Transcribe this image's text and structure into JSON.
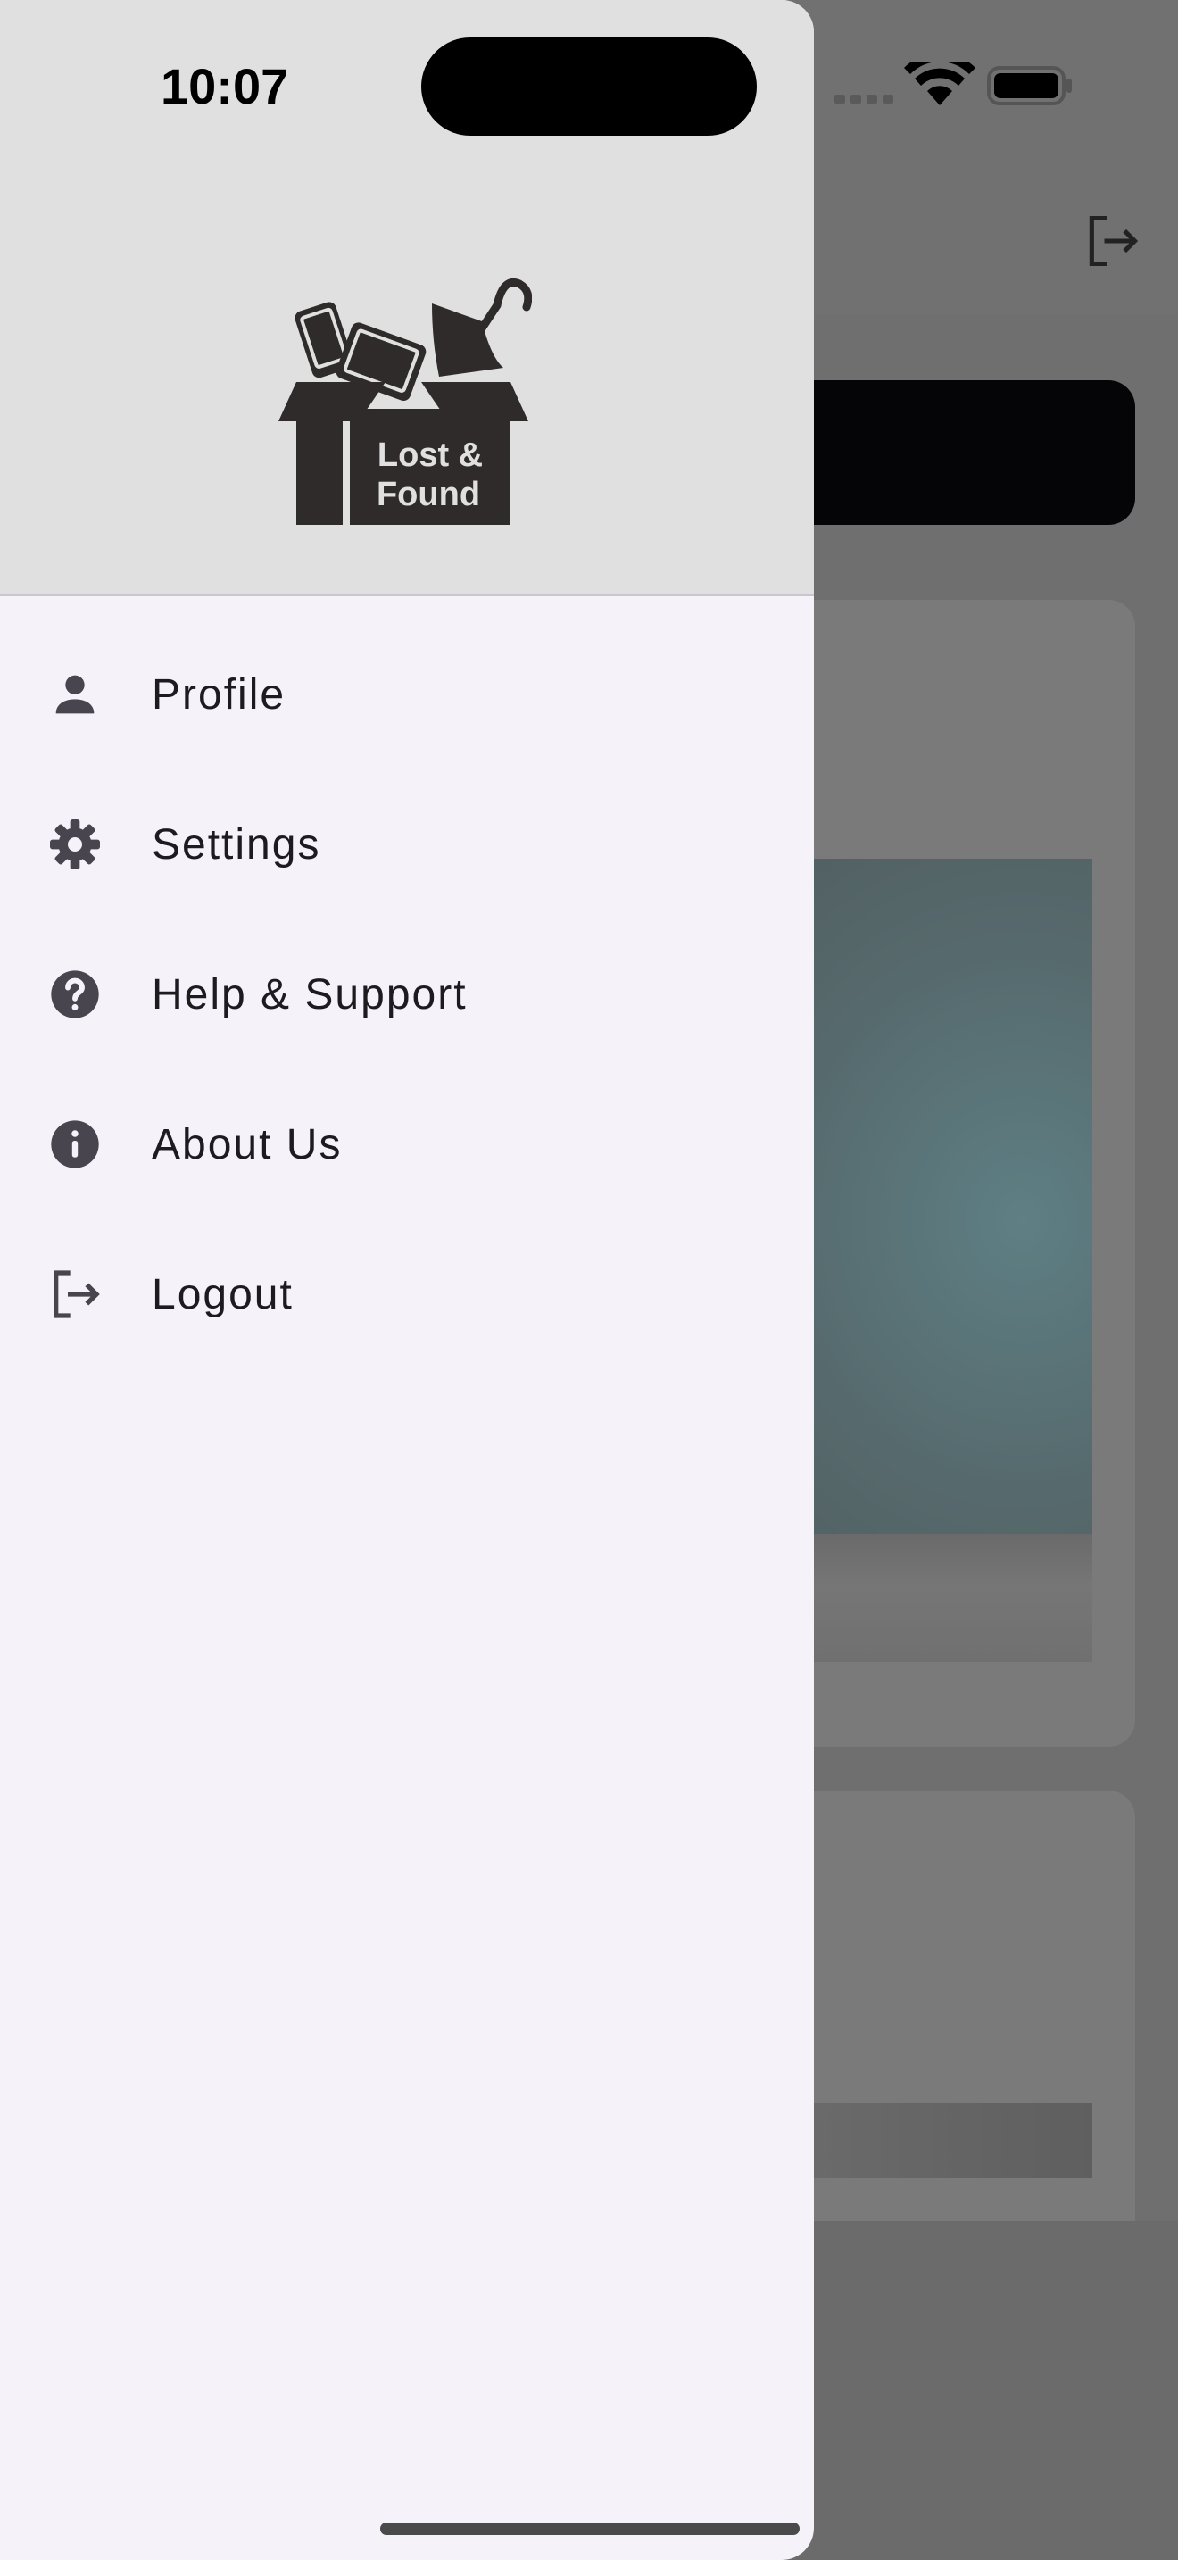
{
  "status_bar": {
    "time": "10:07"
  },
  "drawer": {
    "logo": {
      "line1": "Lost &",
      "line2": "Found"
    },
    "items": [
      {
        "label": "Profile",
        "icon": "person-icon"
      },
      {
        "label": "Settings",
        "icon": "gear-icon"
      },
      {
        "label": "Help & Support",
        "icon": "help-circle-icon"
      },
      {
        "label": "About Us",
        "icon": "info-circle-icon"
      },
      {
        "label": "Logout",
        "icon": "logout-icon"
      }
    ]
  },
  "colors": {
    "drawer_background": "#f6f2f9",
    "drawer_header": "#e1e0e1",
    "icon": "#49454f",
    "scrim": "#6b6b6b"
  }
}
